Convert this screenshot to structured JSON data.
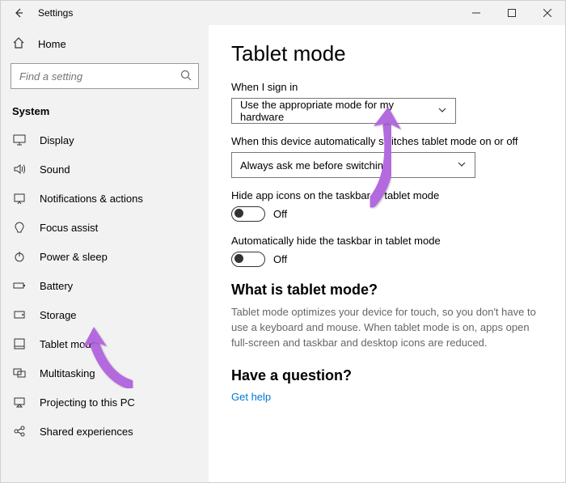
{
  "window": {
    "title": "Settings"
  },
  "sidebar": {
    "home": "Home",
    "search_placeholder": "Find a setting",
    "category": "System",
    "items": [
      {
        "label": "Display",
        "icon": "display"
      },
      {
        "label": "Sound",
        "icon": "sound"
      },
      {
        "label": "Notifications & actions",
        "icon": "notifications"
      },
      {
        "label": "Focus assist",
        "icon": "focus"
      },
      {
        "label": "Power & sleep",
        "icon": "power"
      },
      {
        "label": "Battery",
        "icon": "battery"
      },
      {
        "label": "Storage",
        "icon": "storage"
      },
      {
        "label": "Tablet mode",
        "icon": "tablet"
      },
      {
        "label": "Multitasking",
        "icon": "multitask"
      },
      {
        "label": "Projecting to this PC",
        "icon": "project"
      },
      {
        "label": "Shared experiences",
        "icon": "shared"
      }
    ]
  },
  "page": {
    "title": "Tablet mode",
    "signin_label": "When I sign in",
    "signin_value": "Use the appropriate mode for my hardware",
    "switch_label": "When this device automatically switches tablet mode on or off",
    "switch_value": "Always ask me before switching",
    "hide_icons_label": "Hide app icons on the taskbar in tablet mode",
    "hide_icons_value": "Off",
    "auto_hide_label": "Automatically hide the taskbar in tablet mode",
    "auto_hide_value": "Off",
    "what_title": "What is tablet mode?",
    "what_desc": "Tablet mode optimizes your device for touch, so you don't have to use a keyboard and mouse. When tablet mode is on, apps open full-screen and taskbar and desktop icons are reduced.",
    "question_title": "Have a question?",
    "get_help": "Get help"
  },
  "annotation": {
    "arrow_color": "#b46adf"
  }
}
